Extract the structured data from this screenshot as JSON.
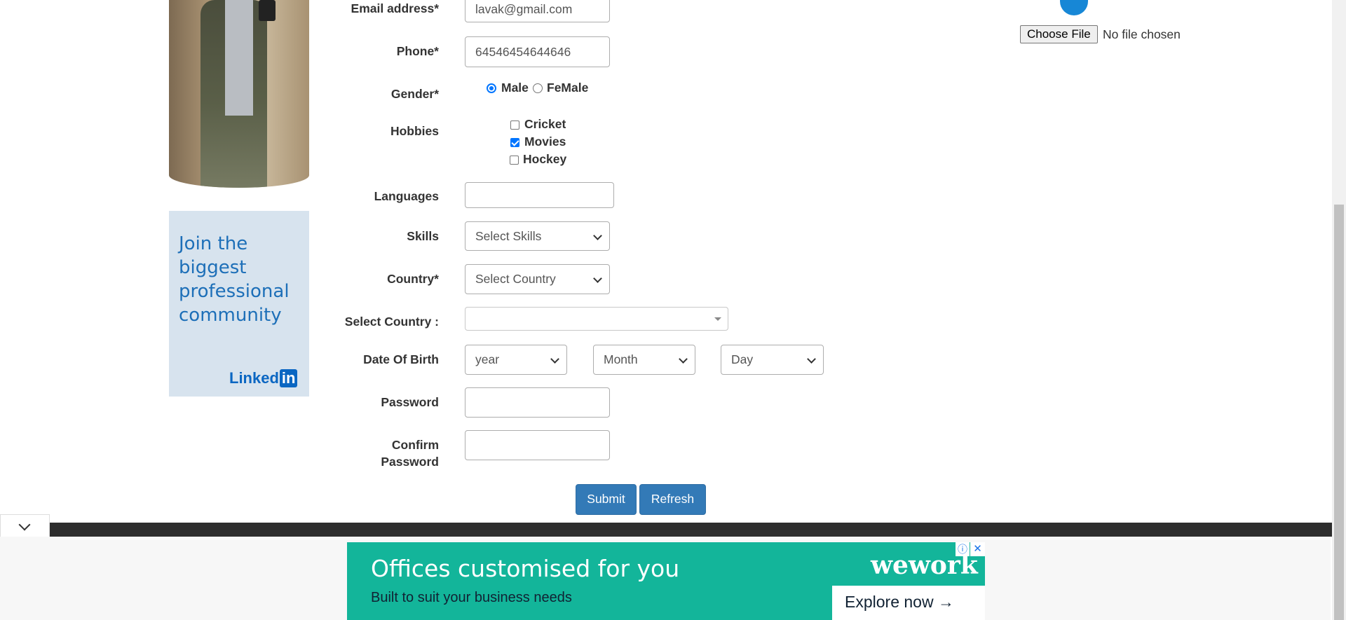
{
  "form": {
    "email": {
      "label": "Email address*",
      "value": "lavak@gmail.com"
    },
    "phone": {
      "label": "Phone*",
      "value": "64546454644646"
    },
    "gender": {
      "label": "Gender*",
      "options": [
        "Male",
        "FeMale"
      ],
      "selected": "Male"
    },
    "hobbies": {
      "label": "Hobbies",
      "options": [
        {
          "label": "Cricket",
          "checked": false
        },
        {
          "label": "Movies",
          "checked": true
        },
        {
          "label": "Hockey",
          "checked": false
        }
      ]
    },
    "languages": {
      "label": "Languages",
      "value": ""
    },
    "skills": {
      "label": "Skills",
      "selected": "Select Skills"
    },
    "country": {
      "label": "Country*",
      "selected": "Select Country"
    },
    "select_country": {
      "label": "Select Country :",
      "selected": ""
    },
    "dob": {
      "label": "Date Of Birth",
      "year": "year",
      "month": "Month",
      "day": "Day"
    },
    "password": {
      "label": "Password",
      "value": ""
    },
    "confirm_password": {
      "label_line1": "Confirm",
      "label_line2": "Password",
      "value": ""
    },
    "submit_label": "Submit",
    "refresh_label": "Refresh"
  },
  "upload": {
    "button_label": "Choose File",
    "status": "No file chosen"
  },
  "sidebar_ad": {
    "line1": "Join the",
    "line2": "biggest",
    "line3": "professional",
    "line4": "community",
    "brand": "Linked",
    "brand_badge": "in"
  },
  "bottom_ad": {
    "headline": "Offices customised for you",
    "subline": "Built to suit your business needs",
    "brand": "wework",
    "cta": "Explore now →"
  },
  "colors": {
    "primary_button": "#337ab7",
    "ad_teal": "#13b59a",
    "linkedin_blue": "#0a66c2",
    "footer_bar": "#2d2d2d",
    "scrollbar": "#c1c1c1"
  }
}
